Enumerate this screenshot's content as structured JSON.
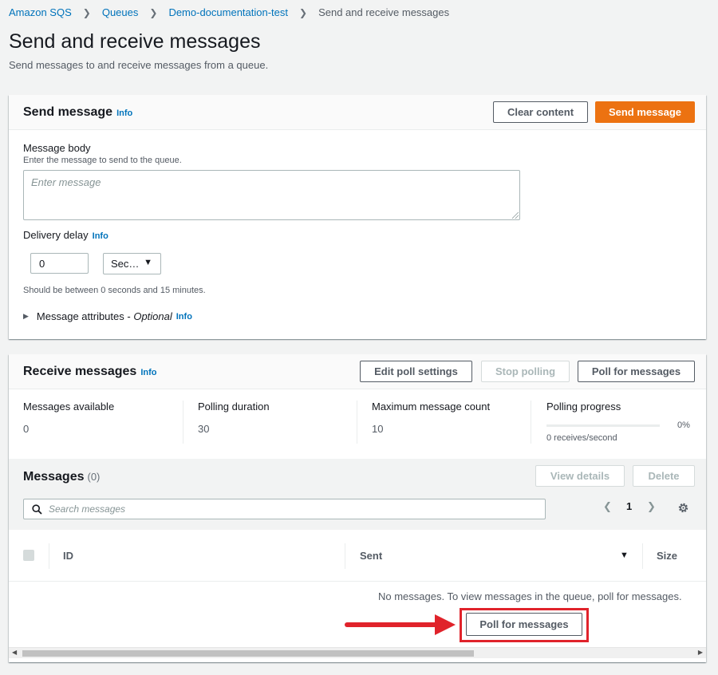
{
  "breadcrumb": [
    {
      "label": "Amazon SQS"
    },
    {
      "label": "Queues"
    },
    {
      "label": "Demo-documentation-test"
    },
    {
      "label": "Send and receive messages"
    }
  ],
  "page": {
    "title": "Send and receive messages",
    "description": "Send messages to and receive messages from a queue."
  },
  "send": {
    "title": "Send message",
    "info": "Info",
    "clear_label": "Clear content",
    "send_label": "Send message",
    "body_label": "Message body",
    "body_hint": "Enter the message to send to the queue.",
    "body_placeholder": "Enter message",
    "delay_label": "Delivery delay",
    "delay_info": "Info",
    "delay_value": "0",
    "delay_unit": "Sec…",
    "delay_hint": "Should be between 0 seconds and 15 minutes.",
    "attributes_label": "Message attributes - ",
    "attributes_optional": "Optional",
    "attributes_info": "Info"
  },
  "receive": {
    "title": "Receive messages",
    "info": "Info",
    "edit_label": "Edit poll settings",
    "stop_label": "Stop polling",
    "poll_label": "Poll for messages",
    "metrics": [
      {
        "label": "Messages available",
        "value": "0"
      },
      {
        "label": "Polling duration",
        "value": "30"
      },
      {
        "label": "Maximum message count",
        "value": "10"
      }
    ],
    "progress_label": "Polling progress",
    "progress_percent": "0%",
    "progress_fraction": 0,
    "progress_rate": "0 receives/second"
  },
  "messages": {
    "title": "Messages",
    "count": "(0)",
    "view_label": "View details",
    "delete_label": "Delete",
    "search_placeholder": "Search messages",
    "page": "1",
    "columns": [
      "ID",
      "Sent",
      "Size"
    ],
    "empty_text": "No messages. To view messages in the queue, poll for messages.",
    "poll_label": "Poll for messages"
  },
  "colors": {
    "accent": "#ec7211",
    "link": "#0073bb",
    "annotation": "#e0232b"
  }
}
